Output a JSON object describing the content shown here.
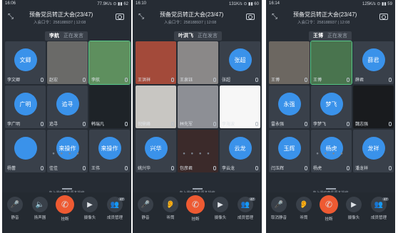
{
  "conference_title": "预备党员转正大会(23/47)",
  "room_number": "入会口令：258188937 | 12:08",
  "speaking_suffix": "正在发言",
  "hint": "向上滑动查看更多操作",
  "panels": [
    {
      "status_time": "16:06",
      "status_right": "77.9K/s ⊙ ▮▮ 62",
      "speaker": "李航",
      "participants": [
        "李文卿",
        "赵宏",
        "李航",
        "李广明",
        "追寻",
        "韩瑞凡",
        "杨蕾",
        "佳佳",
        "王伟"
      ],
      "avatars": [
        "文卿",
        "",
        "",
        "广明",
        "追寻",
        "",
        "",
        "来操作",
        "来操作"
      ],
      "buttons": [
        "静音",
        "扬声器",
        "挂断",
        "摄像头",
        "成员管理"
      ],
      "member_badge": "47"
    },
    {
      "status_time": "16:10",
      "status_right": "131K/s ⊙ ▮▮ 60",
      "speaker": "叶洪飞",
      "participants": [
        "王洪祥",
        "王泉钰",
        "张超",
        "倪鼎峰",
        "林先军",
        "李海波",
        "姚兴华",
        "包彦君",
        "李云龙"
      ],
      "avatars": [
        "",
        "",
        "张超",
        "",
        "",
        "",
        "兴华",
        "",
        "云龙"
      ],
      "buttons": [
        "静音",
        "听筒",
        "挂断",
        "摄像头",
        "成员管理"
      ],
      "member_badge": "47"
    },
    {
      "status_time": "16:14",
      "status_right": "125K/s ⊙ ▮▮ 59",
      "speaker": "王博",
      "participants": [
        "王博",
        "王博",
        "薛君",
        "雷永强",
        "李梦飞",
        "魏志强",
        "闫玉辉",
        "杨虎",
        "潘龙祥"
      ],
      "avatars": [
        "",
        "",
        "薛君",
        "永强",
        "梦飞",
        "",
        "玉辉",
        "杨虎",
        "龙祥"
      ],
      "buttons": [
        "取消静音",
        "听筒",
        "挂断",
        "摄像头",
        "成员管理"
      ],
      "member_badge": "47"
    }
  ],
  "icons": {
    "back": "collapse-icon",
    "camera": "switch-camera-icon",
    "mic": "mic-icon",
    "speaker": "speaker-icon",
    "hang": "hang-up-icon",
    "video": "camera-icon",
    "members": "members-icon"
  },
  "colors": {
    "accent": "#3a92ea",
    "hangup": "#ee5a32",
    "active": "#58c98a"
  }
}
